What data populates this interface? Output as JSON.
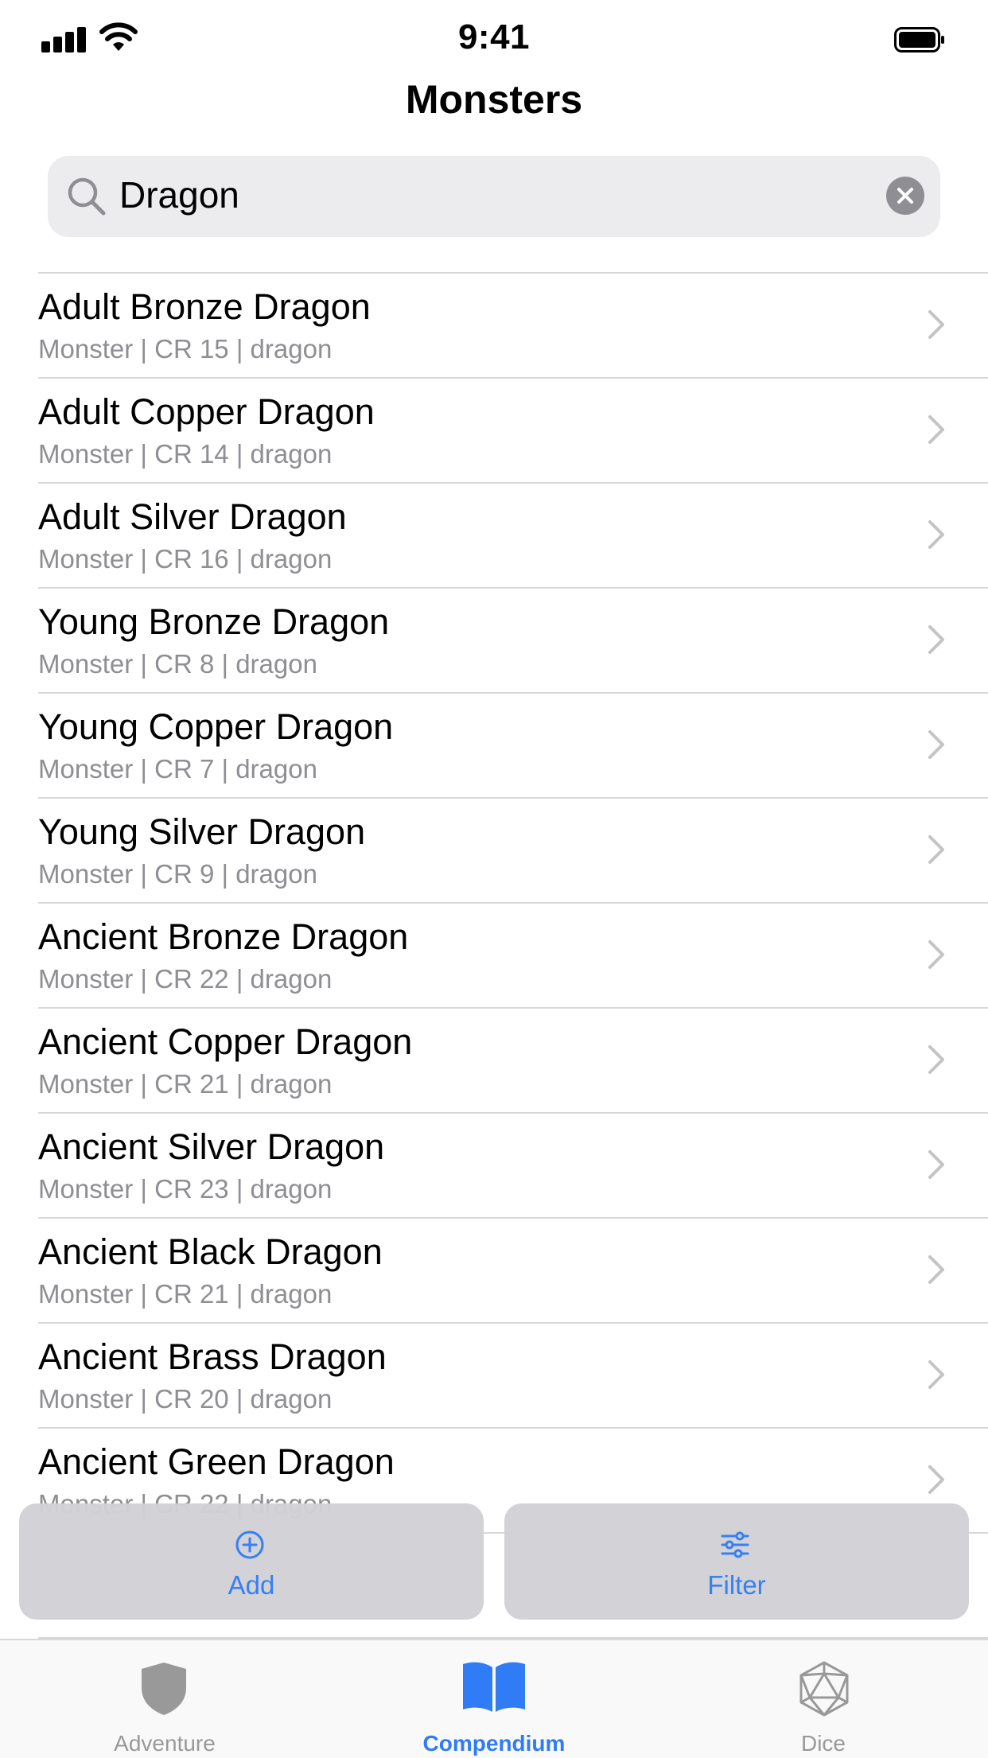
{
  "status_bar": {
    "time": "9:41"
  },
  "nav": {
    "title": "Monsters"
  },
  "search": {
    "query": "Dragon"
  },
  "list": {
    "rows": [
      {
        "title": "Adult Bronze Dragon",
        "subtitle": "Monster | CR 15 | dragon"
      },
      {
        "title": "Adult Copper Dragon",
        "subtitle": "Monster | CR 14 | dragon"
      },
      {
        "title": "Adult Silver Dragon",
        "subtitle": "Monster | CR 16 | dragon"
      },
      {
        "title": "Young Bronze Dragon",
        "subtitle": "Monster | CR 8 | dragon"
      },
      {
        "title": "Young Copper Dragon",
        "subtitle": "Monster | CR 7 | dragon"
      },
      {
        "title": "Young Silver Dragon",
        "subtitle": "Monster | CR 9 | dragon"
      },
      {
        "title": "Ancient Bronze Dragon",
        "subtitle": "Monster | CR 22 | dragon"
      },
      {
        "title": "Ancient Copper Dragon",
        "subtitle": "Monster | CR 21 | dragon"
      },
      {
        "title": "Ancient Silver Dragon",
        "subtitle": "Monster | CR 23 | dragon"
      },
      {
        "title": "Ancient Black Dragon",
        "subtitle": "Monster | CR 21 | dragon"
      },
      {
        "title": "Ancient Brass Dragon",
        "subtitle": "Monster | CR 20 | dragon"
      },
      {
        "title": "Ancient Green Dragon",
        "subtitle": "Monster | CR 22 | dragon"
      },
      {
        "title": "",
        "subtitle": ""
      }
    ]
  },
  "actions": {
    "add": {
      "label": "Add",
      "icon": "plus-circle-icon"
    },
    "filter": {
      "label": "Filter",
      "icon": "sliders-icon"
    }
  },
  "tab_bar": {
    "tabs": [
      {
        "label": "Adventure",
        "icon": "shield-icon",
        "active": false
      },
      {
        "label": "Compendium",
        "icon": "book-icon",
        "active": true
      },
      {
        "label": "Dice",
        "icon": "d20-icon",
        "active": false
      }
    ]
  },
  "colors": {
    "accent": "#2f7cf6",
    "inactive": "#999999",
    "secondary_text": "#8e8e93"
  }
}
